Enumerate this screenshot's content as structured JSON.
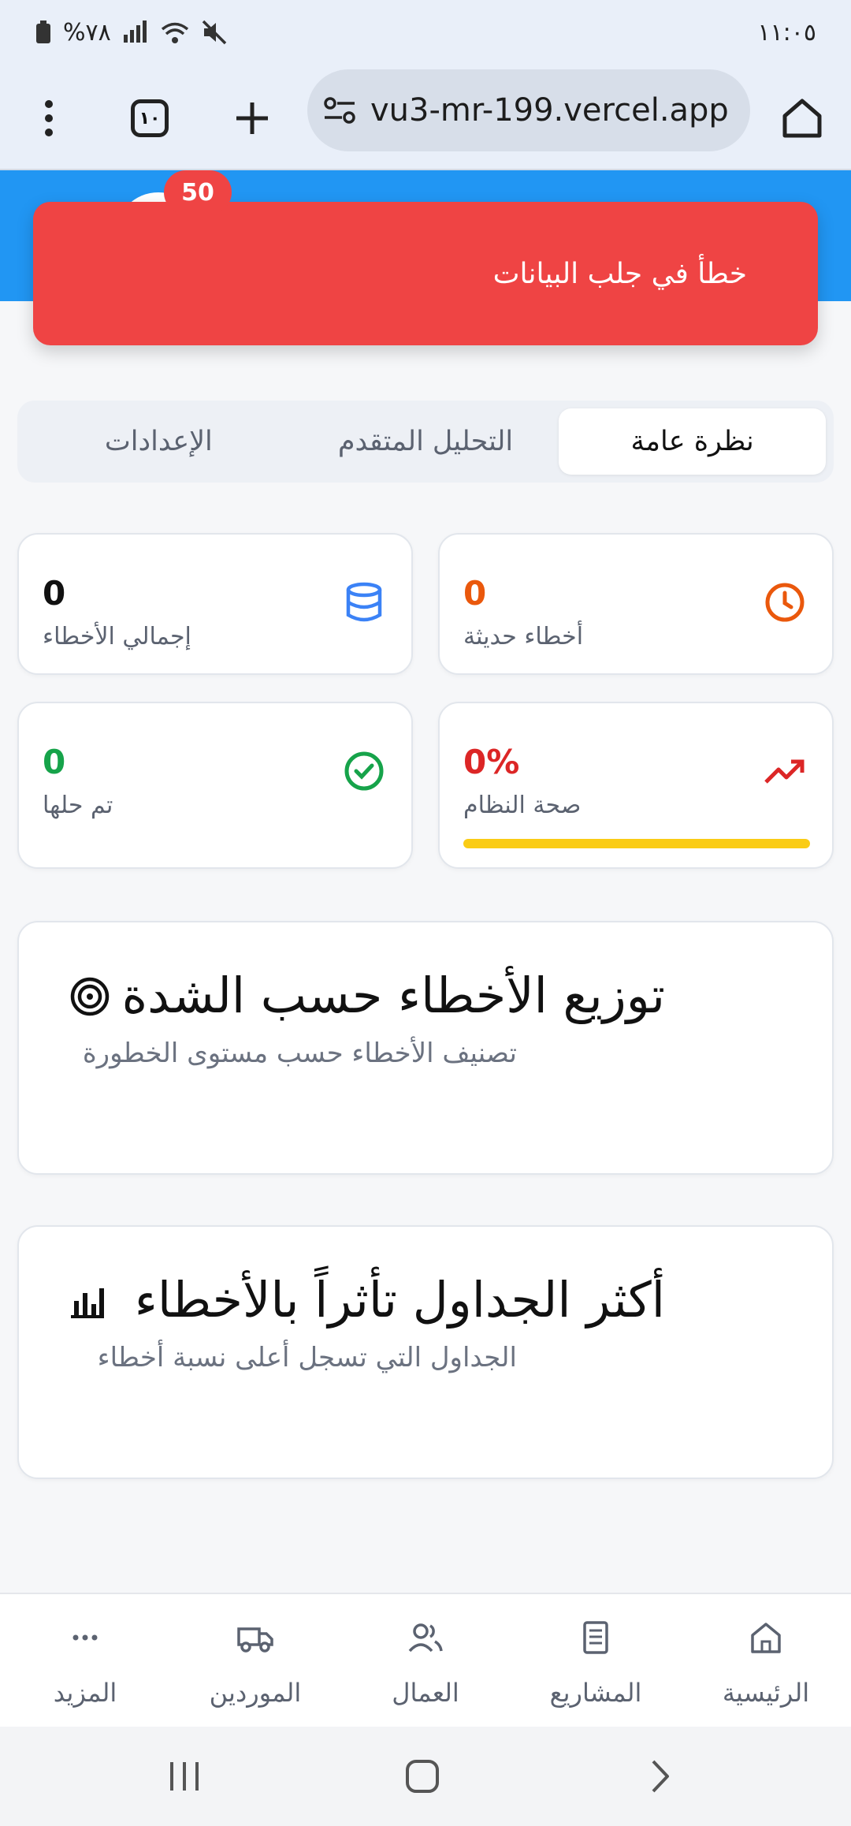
{
  "status_bar": {
    "time": "١١:٠٥",
    "battery": "%٧٨"
  },
  "browser": {
    "url": "vu3-mr-199.vercel.app",
    "tab_count": "١٠"
  },
  "header": {
    "notification_count": "50"
  },
  "toast": {
    "message": "خطأ في جلب البيانات"
  },
  "tabs": [
    {
      "label": "نظرة عامة",
      "active": true
    },
    {
      "label": "التحليل المتقدم",
      "active": false
    },
    {
      "label": "الإعدادات",
      "active": false
    }
  ],
  "stats": {
    "total_errors": {
      "value": "0",
      "label": "إجمالي الأخطاء"
    },
    "recent_errors": {
      "value": "0",
      "label": "أخطاء حديثة"
    },
    "resolved": {
      "value": "0",
      "label": "تم حلها"
    },
    "system_health": {
      "value": "0%",
      "label": "صحة النظام"
    }
  },
  "severity_card": {
    "title": "توزيع الأخطاء حسب الشدة",
    "subtitle": "تصنيف الأخطاء حسب مستوى الخطورة"
  },
  "tables_card": {
    "title": "أكثر الجداول تأثراً بالأخطاء",
    "subtitle": "الجداول التي تسجل أعلى نسبة أخطاء"
  },
  "bottom_nav": [
    {
      "label": "الرئيسية",
      "icon": "home-icon"
    },
    {
      "label": "المشاريع",
      "icon": "projects-icon"
    },
    {
      "label": "العمال",
      "icon": "users-icon"
    },
    {
      "label": "الموردين",
      "icon": "truck-icon"
    },
    {
      "label": "المزيد",
      "icon": "more-icon"
    }
  ],
  "colors": {
    "header_blue": "#2196f3",
    "error_red": "#ef4444",
    "recent_orange": "#ea580c",
    "resolved_green": "#16a34a",
    "health_red": "#dc2626",
    "health_bar": "#facc15",
    "db_blue": "#3b82f6"
  }
}
